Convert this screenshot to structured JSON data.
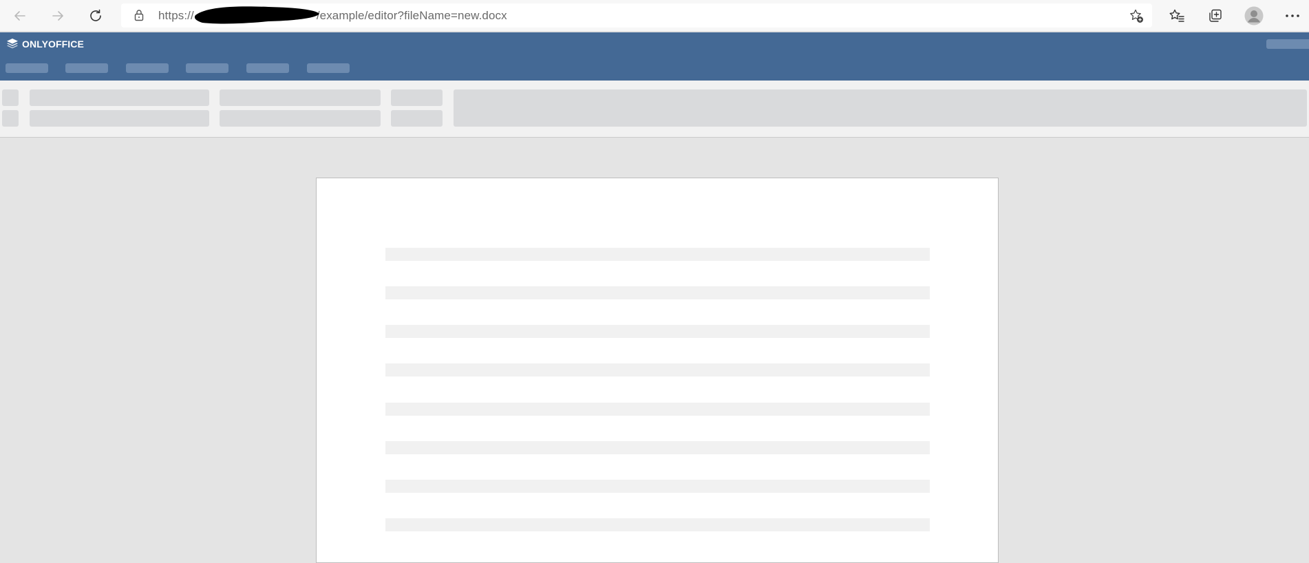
{
  "browser": {
    "url_protocol": "https://",
    "url_path": "/example/editor?fileName=new.docx",
    "icons": {
      "back": "arrow-left-icon",
      "forward": "arrow-right-icon",
      "refresh": "refresh-icon",
      "lock": "lock-icon",
      "add_favorite": "star-plus-icon",
      "favorites": "favorites-list-icon",
      "collections": "collections-icon",
      "profile": "avatar-icon",
      "more": "ellipsis-icon"
    }
  },
  "app": {
    "logo_text": "ONLYOFFICE",
    "header_color": "#446995",
    "placeholder_color": "#6d8bb0",
    "menu_tab_count": 6
  },
  "document": {
    "loading_line_count": 8
  }
}
